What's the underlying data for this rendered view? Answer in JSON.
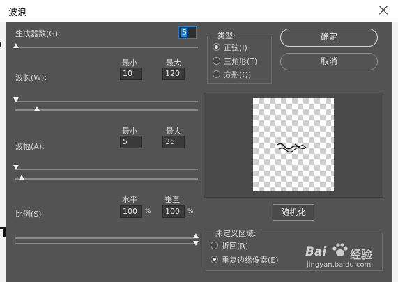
{
  "window": {
    "title": "波浪"
  },
  "generators": {
    "label": "生成器数(G):",
    "value": "5"
  },
  "wavelength": {
    "label": "波长(W):",
    "min_label": "最小",
    "max_label": "最大",
    "min": "10",
    "max": "120"
  },
  "amplitude": {
    "label": "波幅(A):",
    "min_label": "最小",
    "max_label": "最大",
    "min": "5",
    "max": "35"
  },
  "scale": {
    "label": "比例(S):",
    "h_label": "水平",
    "v_label": "垂直",
    "h": "100",
    "v": "100",
    "unit": "%"
  },
  "type_group": {
    "legend": "类型:",
    "options": [
      {
        "label": "正弦(I)",
        "selected": true
      },
      {
        "label": "三角形(T)",
        "selected": false
      },
      {
        "label": "方形(Q)",
        "selected": false
      }
    ]
  },
  "buttons": {
    "ok": "确定",
    "cancel": "取消",
    "randomize": "随机化"
  },
  "undefined_area": {
    "legend": "未定义区域:",
    "options": [
      {
        "label": "折回(R)",
        "selected": false
      },
      {
        "label": "重复边缘像素(E)",
        "selected": true
      }
    ]
  },
  "watermark": {
    "brand": "Bai",
    "brand2": "经验",
    "url": "jingyan.baidu.com"
  }
}
